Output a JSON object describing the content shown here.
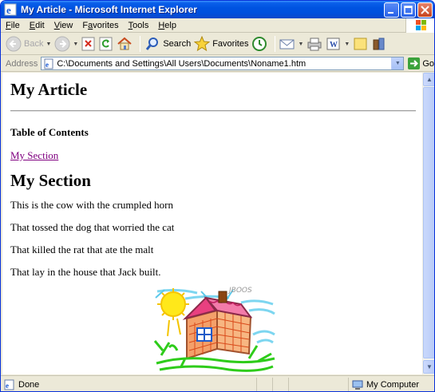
{
  "window": {
    "title": "My Article - Microsoft Internet Explorer"
  },
  "menu": [
    {
      "label": "File",
      "accel": "F"
    },
    {
      "label": "Edit",
      "accel": "E"
    },
    {
      "label": "View",
      "accel": "V"
    },
    {
      "label": "Favorites",
      "accel": "a"
    },
    {
      "label": "Tools",
      "accel": "T"
    },
    {
      "label": "Help",
      "accel": "H"
    }
  ],
  "toolbar": {
    "back_label": "Back",
    "search_label": "Search",
    "favorites_label": "Favorites",
    "word_label": "W"
  },
  "address": {
    "label": "Address",
    "value": "C:\\Documents and Settings\\All Users\\Documents\\Noname1.htm",
    "go_label": "Go"
  },
  "page": {
    "heading": "My Article",
    "toc_heading": "Table of Contents",
    "toc_link": "My Section",
    "section_heading": "My Section",
    "lines": [
      "This is the cow with the crumpled horn",
      "That tossed the dog that worried the cat",
      "That killed the rat that ate the malt",
      "That lay in the house that Jack built."
    ],
    "image_caption": "JBOOS"
  },
  "status": {
    "text": "Done",
    "zone": "My Computer"
  },
  "colors": {
    "titlebar": "#0053E1",
    "visited_link": "#800080",
    "chrome": "#ECE9D8"
  }
}
